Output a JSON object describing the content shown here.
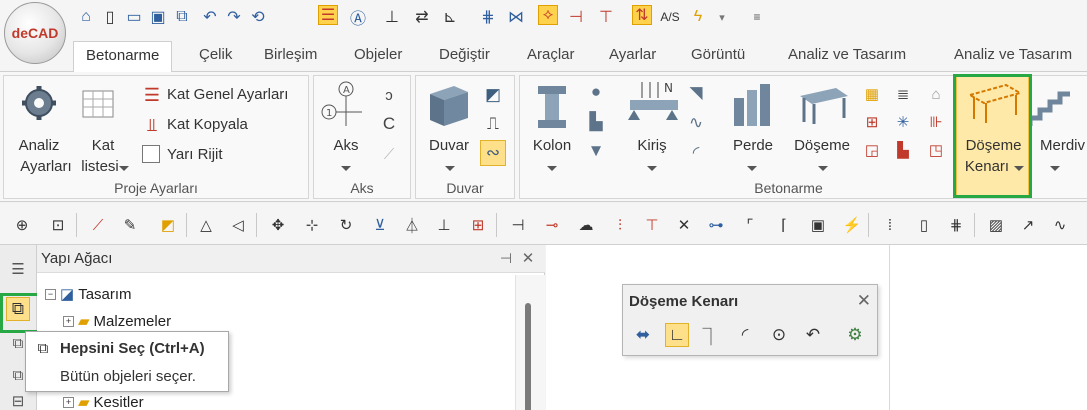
{
  "app": {
    "logo_text": "deCAD"
  },
  "quick_access": {
    "icons": [
      "home-icon",
      "new-file-icon",
      "open-folder-icon",
      "save-icon",
      "save-all-icon",
      "undo-icon",
      "redo-icon",
      "refresh-view-icon",
      "layers-icon",
      "text-box-icon",
      "dimension-icon",
      "align-icon",
      "axis-icon",
      "grid-icon",
      "snap-icon",
      "snap-active-icon",
      "break-icon",
      "split-icon",
      "up-down-arrow-icon",
      "text-style-icon",
      "lightning-icon",
      "dropdown-icon",
      "customize-icon"
    ]
  },
  "tabs": [
    "Betonarme",
    "Çelik",
    "Birleşim",
    "Objeler",
    "Değiştir",
    "Araçlar",
    "Ayarlar",
    "Görüntü",
    "Analiz ve Tasarım",
    "Analiz ve Tasarım"
  ],
  "active_tab": "Betonarme",
  "ribbon": {
    "proje_ayarlari": {
      "label": "Proje Ayarları",
      "analiz_line1": "Analiz",
      "analiz_line2": "Ayarları",
      "kat_line1": "Kat",
      "kat_line2": "listesi",
      "kat_genel": "Kat Genel Ayarları",
      "kat_kopyala": "Kat Kopyala",
      "yari_rijit": "Yarı Rijit"
    },
    "aks": {
      "label": "Aks",
      "button": "Aks"
    },
    "duvar": {
      "label": "Duvar",
      "button": "Duvar"
    },
    "betonarme": {
      "label": "Betonarme",
      "kolon": "Kolon",
      "kiris": "Kiriş",
      "perde": "Perde",
      "doseme": "Döşeme",
      "doseme_kenari_line1": "Döşeme",
      "doseme_kenari_line2": "Kenarı",
      "merdiven": "Merdiv"
    }
  },
  "tree": {
    "title": "Yapı Ağacı",
    "pin": "⊣",
    "close": "✕",
    "nodes": [
      {
        "label": "Tasarım",
        "expander": "−"
      },
      {
        "label": "Malzemeler",
        "expander": "+"
      },
      {
        "label": "Kesitler",
        "expander": "+"
      }
    ]
  },
  "floating_toolbar": {
    "title": "Döşeme Kenarı",
    "close": "✕",
    "icons": [
      "slab-edge-icon",
      "corner-edge-icon",
      "angled-edge-icon",
      "curve-edge-icon",
      "circle-edge-icon",
      "arc-edge-icon",
      "settings-gear-icon"
    ]
  },
  "tooltip": {
    "title": "Hepsini Seç (Ctrl+A)",
    "description": "Bütün objeleri seçer."
  },
  "colors": {
    "highlight_green": "#28a745",
    "selected_yellow": "#ffe9a8",
    "accent_blue": "#2f5f9e"
  }
}
